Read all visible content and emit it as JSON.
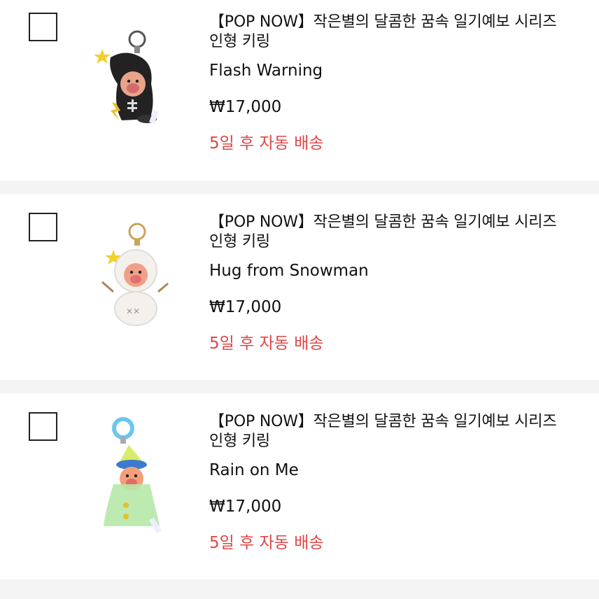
{
  "items": [
    {
      "title": "【POP NOW】작은별의 달콤한 꿈속 일기예보 시리즈 인형 키링",
      "option": "Flash Warning",
      "price": "₩17,000",
      "delivery": "5일 후 자동 배송",
      "image_icon": "black-doll-keychain-icon",
      "checked": false
    },
    {
      "title": "【POP NOW】작은별의 달콤한 꿈속 일기예보 시리즈 인형 키링",
      "option": "Hug from Snowman",
      "price": "₩17,000",
      "delivery": "5일 후 자동 배송",
      "image_icon": "snowman-doll-keychain-icon",
      "checked": false
    },
    {
      "title": "【POP NOW】작은별의 달콤한 꿈속 일기예보 시리즈 인형 키링",
      "option": "Rain on Me",
      "price": "₩17,000",
      "delivery": "5일 후 자동 배송",
      "image_icon": "raincoat-doll-keychain-icon",
      "checked": false
    }
  ],
  "colors": {
    "delivery_text": "#e04545",
    "page_background": "#f4f4f4",
    "card_background": "#ffffff"
  }
}
